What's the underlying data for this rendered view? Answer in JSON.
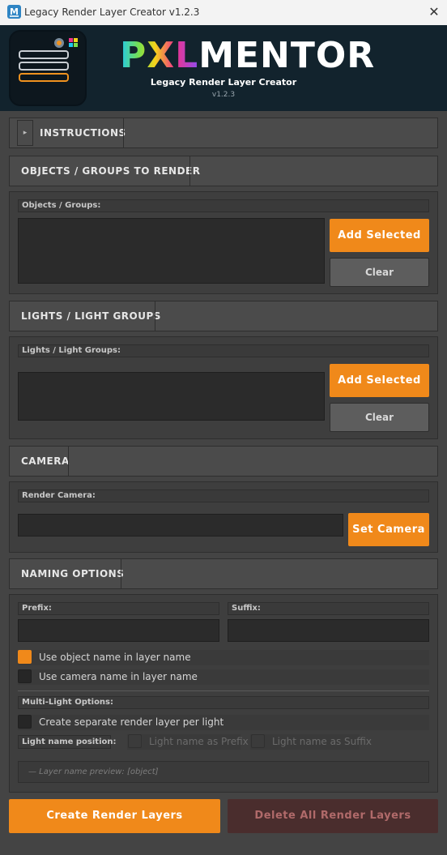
{
  "window": {
    "title": "Legacy Render Layer Creator v1.2.3",
    "app_icon": "M",
    "close_glyph": "✕"
  },
  "banner": {
    "brand_prefix": "PXL",
    "brand_suffix": "MENTOR",
    "subtitle": "Legacy Render Layer Creator",
    "version": "v1.2.3",
    "background": "#12232d"
  },
  "instructions": {
    "toggle_glyph": "▸",
    "title": "INSTRUCTIONS"
  },
  "objects": {
    "title": "OBJECTS / GROUPS TO RENDER",
    "field_label": "Objects / Groups:",
    "add_label": "Add Selected",
    "clear_label": "Clear",
    "items": []
  },
  "lights": {
    "title": "LIGHTS / LIGHT GROUPS",
    "field_label": "Lights / Light Groups:",
    "add_label": "Add Selected",
    "clear_label": "Clear",
    "items": []
  },
  "camera": {
    "title": "CAMERA",
    "field_label": "Render Camera:",
    "value": "",
    "set_label": "Set Camera"
  },
  "naming": {
    "title": "NAMING OPTIONS",
    "prefix_label": "Prefix:",
    "prefix_value": "",
    "suffix_label": "Suffix:",
    "suffix_value": "",
    "use_object_name_label": "Use object name in layer name",
    "use_object_name": true,
    "use_camera_name_label": "Use camera name in layer name",
    "use_camera_name": false,
    "multi_light_label": "Multi-Light Options:",
    "separate_per_light_label": "Create separate render layer per light",
    "separate_per_light": false,
    "light_position_label": "Light name position:",
    "light_as_prefix_label": "Light name as Prefix",
    "light_as_suffix_label": "Light name as Suffix",
    "preview_text": "— Layer name preview: [object]"
  },
  "actions": {
    "create_label": "Create Render Layers",
    "delete_label": "Delete All Render Layers"
  },
  "colors": {
    "accent": "#f0891a",
    "panel": "#444444",
    "danger": "#4a2d2d"
  }
}
